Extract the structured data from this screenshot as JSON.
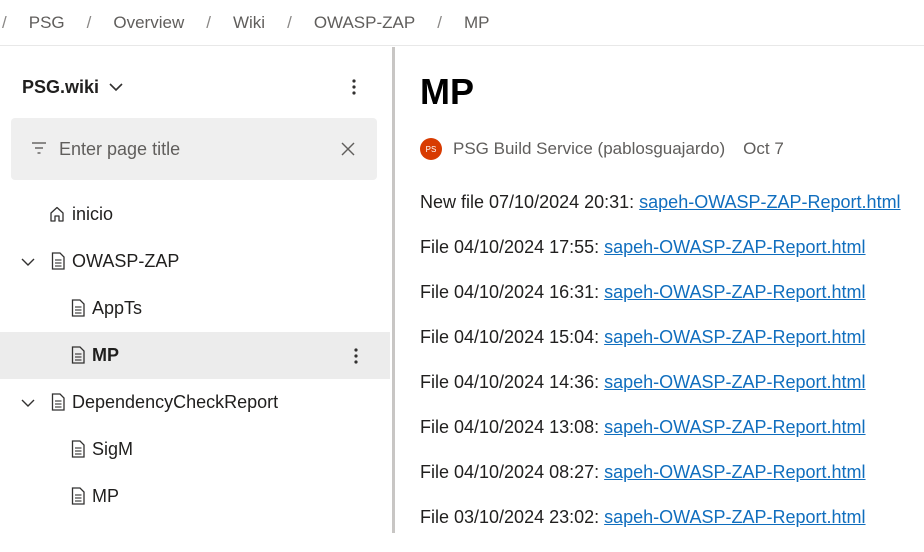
{
  "breadcrumb": [
    {
      "sep": "/",
      "label": "PSG"
    },
    {
      "sep": "/",
      "label": "Overview"
    },
    {
      "sep": "/",
      "label": "Wiki"
    },
    {
      "sep": "/",
      "label": "OWASP-ZAP"
    },
    {
      "sep": "/",
      "label": "MP"
    }
  ],
  "sidebar": {
    "wiki_name": "PSG.wiki",
    "filter_placeholder": "Enter page title",
    "items": [
      {
        "label": "inicio",
        "icon": "home-icon"
      },
      {
        "label": "OWASP-ZAP",
        "icon": "page-icon",
        "expanded": true
      },
      {
        "label": "AppTs",
        "icon": "page-icon"
      },
      {
        "label": "MP",
        "icon": "page-icon",
        "selected": true
      },
      {
        "label": "DependencyCheckReport",
        "icon": "page-icon",
        "expanded": true
      },
      {
        "label": "SigM",
        "icon": "page-icon"
      },
      {
        "label": "MP",
        "icon": "page-icon"
      }
    ]
  },
  "main": {
    "title": "MP",
    "avatar_initials": "PS",
    "author": "PSG Build Service (pablosguajardo)",
    "date": "Oct 7",
    "entries": [
      {
        "prefix": "New file 07/10/2024 20:31: ",
        "link": "sapeh-OWASP-ZAP-Report.html"
      },
      {
        "prefix": "File 04/10/2024 17:55: ",
        "link": "sapeh-OWASP-ZAP-Report.html"
      },
      {
        "prefix": "File 04/10/2024 16:31: ",
        "link": "sapeh-OWASP-ZAP-Report.html"
      },
      {
        "prefix": "File 04/10/2024 15:04: ",
        "link": "sapeh-OWASP-ZAP-Report.html"
      },
      {
        "prefix": "File 04/10/2024 14:36: ",
        "link": "sapeh-OWASP-ZAP-Report.html"
      },
      {
        "prefix": "File 04/10/2024 13:08: ",
        "link": "sapeh-OWASP-ZAP-Report.html"
      },
      {
        "prefix": "File 04/10/2024 08:27: ",
        "link": "sapeh-OWASP-ZAP-Report.html"
      },
      {
        "prefix": "File 03/10/2024 23:02: ",
        "link": "sapeh-OWASP-ZAP-Report.html"
      }
    ]
  },
  "colors": {
    "link": "#106ebe",
    "avatar": "#d83b01",
    "selected_bg": "#ececec",
    "filter_bg": "#efefef"
  }
}
